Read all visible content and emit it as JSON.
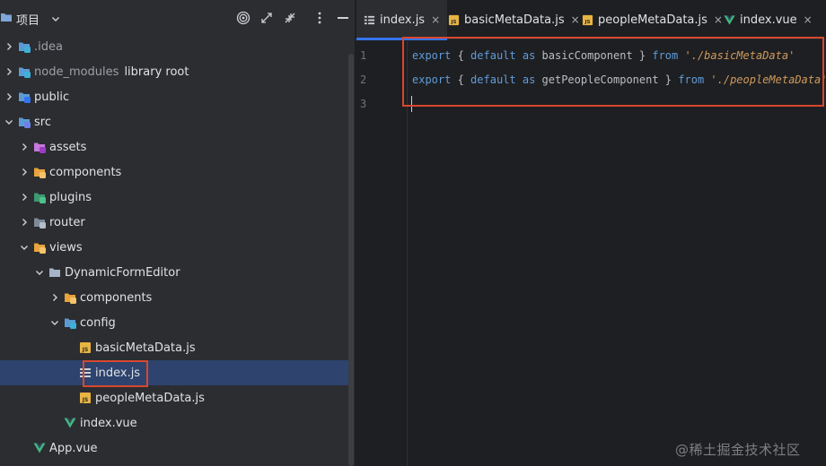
{
  "project_panel": {
    "title": "项目",
    "header_actions": [
      {
        "name": "locate-icon"
      },
      {
        "name": "expand-all-icon"
      },
      {
        "name": "collapse-all-icon"
      },
      {
        "name": "more-options-icon"
      },
      {
        "name": "hide-panel-icon"
      }
    ],
    "tree": [
      {
        "label": ".idea",
        "depth": 0,
        "expanded": false,
        "icon": "folder-config-icon",
        "muted": true
      },
      {
        "label": "node_modules",
        "hint": "library root",
        "depth": 0,
        "expanded": false,
        "icon": "folder-library-icon",
        "muted": true
      },
      {
        "label": "public",
        "depth": 0,
        "expanded": false,
        "icon": "folder-web-icon"
      },
      {
        "label": "src",
        "depth": 0,
        "expanded": true,
        "icon": "folder-source-icon"
      },
      {
        "label": "assets",
        "depth": 1,
        "expanded": false,
        "icon": "folder-assets-icon"
      },
      {
        "label": "components",
        "depth": 1,
        "expanded": false,
        "icon": "folder-components-icon"
      },
      {
        "label": "plugins",
        "depth": 1,
        "expanded": false,
        "icon": "folder-plugins-icon"
      },
      {
        "label": "router",
        "depth": 1,
        "expanded": false,
        "icon": "folder-router-icon"
      },
      {
        "label": "views",
        "depth": 1,
        "expanded": true,
        "icon": "folder-views-icon"
      },
      {
        "label": "DynamicFormEditor",
        "depth": 2,
        "expanded": true,
        "icon": "folder-icon"
      },
      {
        "label": "components",
        "depth": 3,
        "expanded": false,
        "icon": "folder-components-icon"
      },
      {
        "label": "config",
        "depth": 3,
        "expanded": true,
        "icon": "folder-config-icon"
      },
      {
        "label": "basicMetaData.js",
        "depth": 4,
        "icon": "js-file-icon"
      },
      {
        "label": "index.js",
        "depth": 4,
        "icon": "js-structure-icon",
        "selected": true
      },
      {
        "label": "peopleMetaData.js",
        "depth": 4,
        "icon": "js-file-icon"
      },
      {
        "label": "index.vue",
        "depth": 3,
        "icon": "vue-file-icon"
      },
      {
        "label": "App.vue",
        "depth": 1,
        "icon": "vue-file-icon"
      }
    ]
  },
  "editor": {
    "tabs": [
      {
        "label": "index.js",
        "icon": "js-structure-icon",
        "active": true
      },
      {
        "label": "basicMetaData.js",
        "icon": "js-file-icon"
      },
      {
        "label": "peopleMetaData.js",
        "icon": "js-file-icon"
      },
      {
        "label": "index.vue",
        "icon": "vue-file-icon"
      }
    ],
    "tab_close_glyph": "×",
    "line_numbers": [
      "1",
      "2",
      "3"
    ],
    "code_lines": [
      [
        {
          "t": "export",
          "c": "kw"
        },
        {
          "t": " { ",
          "c": "pl"
        },
        {
          "t": "default",
          "c": "kw"
        },
        {
          "t": " ",
          "c": "pl"
        },
        {
          "t": "as",
          "c": "kw"
        },
        {
          "t": " basicComponent } ",
          "c": "pl"
        },
        {
          "t": "from",
          "c": "kw"
        },
        {
          "t": " ",
          "c": "pl"
        },
        {
          "t": "'./basicMetaData'",
          "c": "str"
        }
      ],
      [
        {
          "t": "export",
          "c": "kw"
        },
        {
          "t": " { ",
          "c": "pl"
        },
        {
          "t": "default",
          "c": "kw"
        },
        {
          "t": " ",
          "c": "pl"
        },
        {
          "t": "as",
          "c": "kw"
        },
        {
          "t": " getPeopleComponent } ",
          "c": "pl"
        },
        {
          "t": "from",
          "c": "kw"
        },
        {
          "t": " ",
          "c": "pl"
        },
        {
          "t": "'./peopleMetaData'",
          "c": "str"
        }
      ],
      []
    ]
  },
  "watermark": "@稀土掘金技术社区",
  "colors": {
    "panel_bg": "#2b2d30",
    "editor_bg": "#1e1f22",
    "selection": "#2e436e",
    "annotation_red": "#d9472f",
    "keyword": "#5f9cd8",
    "string": "#d09a5c"
  }
}
